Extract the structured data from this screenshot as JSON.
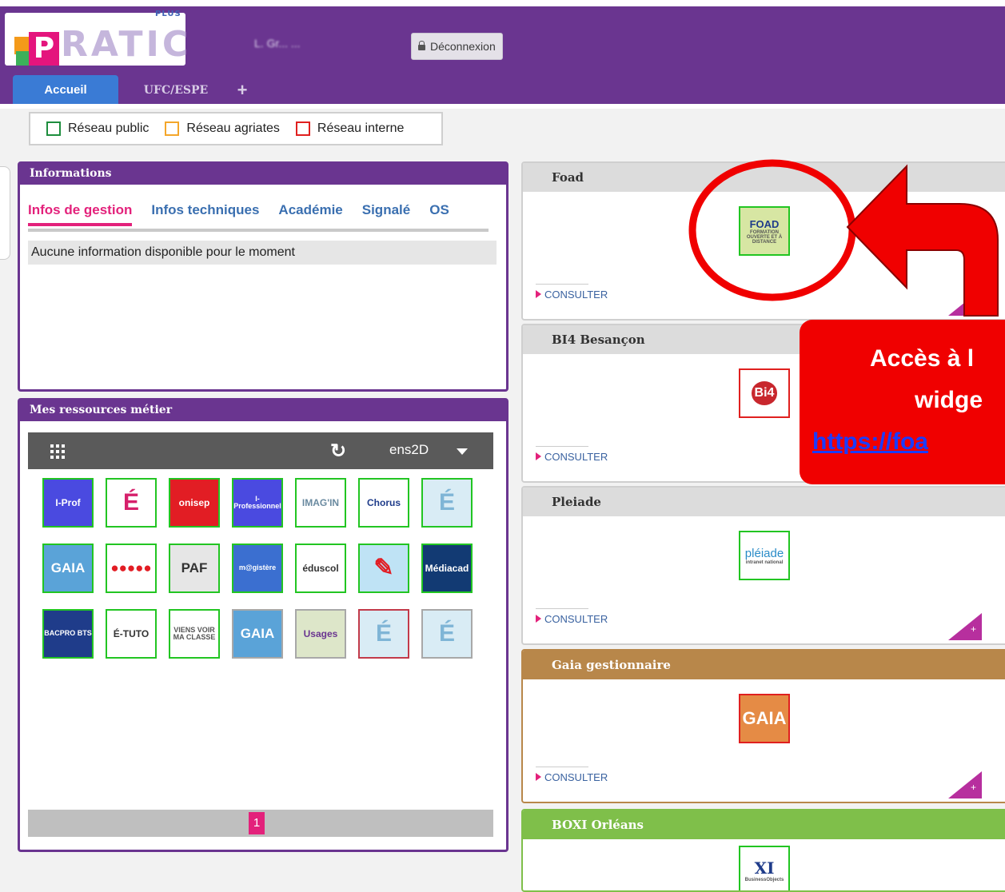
{
  "header": {
    "logo_plus": "PLUS",
    "logo_p": "P",
    "logo_word": "RATIC",
    "user_name": "L. Gr... ...",
    "logout_label": "Déconnexion",
    "tabs": [
      {
        "label": "Accueil"
      },
      {
        "label": "UFC/ESPE"
      },
      {
        "label": "+"
      }
    ]
  },
  "legend": {
    "items": [
      {
        "label": "Réseau public",
        "color": "#1e8e3e"
      },
      {
        "label": "Réseau agriates",
        "color": "#f4a62a"
      },
      {
        "label": "Réseau interne",
        "color": "#e0201f"
      }
    ]
  },
  "informations": {
    "title": "Informations",
    "tabs": [
      "Infos de gestion",
      "Infos techniques",
      "Académie",
      "Signalé",
      "OS"
    ],
    "active_tab": "Infos de gestion",
    "message": "Aucune information disponible pour le moment"
  },
  "ressources": {
    "title": "Mes ressources métier",
    "profile": "ens2D",
    "page": "1",
    "tiles": [
      {
        "label": "I-Prof",
        "bg": "#4a4ae0",
        "fg": "#ffffff"
      },
      {
        "label": "É",
        "bg": "#ffffff",
        "fg": "#d6206b"
      },
      {
        "label": "onisep",
        "bg": "#e21d24",
        "fg": "#ffffff"
      },
      {
        "label": "I-Professionnel",
        "bg": "#4a4ae0",
        "fg": "#ffffff"
      },
      {
        "label": "IMAG'IN",
        "bg": "#ffffff",
        "fg": "#6a8aa0"
      },
      {
        "label": "Chorus",
        "bg": "#ffffff",
        "fg": "#1f3c8a"
      },
      {
        "label": "É",
        "bg": "#d9ecf5",
        "fg": "#7fb5d6"
      },
      {
        "label": "GAIA",
        "bg": "#5aa3d8",
        "fg": "#ffffff"
      },
      {
        "label": "●●●●●",
        "bg": "#ffffff",
        "fg": "#e21d24"
      },
      {
        "label": "PAF",
        "bg": "#e6e6e6",
        "fg": "#333333"
      },
      {
        "label": "m@gistère",
        "bg": "#3b6fd0",
        "fg": "#ffffff"
      },
      {
        "label": "éduscol",
        "bg": "#ffffff",
        "fg": "#333333"
      },
      {
        "label": "✎",
        "bg": "#bfe3f5",
        "fg": "#e21d24"
      },
      {
        "label": "Médiacad",
        "bg": "#123a73",
        "fg": "#ffffff"
      },
      {
        "label": "BACPRO BTS",
        "bg": "#1f3c8a",
        "fg": "#ffffff"
      },
      {
        "label": "É-TUTO",
        "bg": "#ffffff",
        "fg": "#333333"
      },
      {
        "label": "VIENS VOIR MA CLASSE",
        "bg": "#ffffff",
        "fg": "#555555"
      },
      {
        "label": "GAIA",
        "bg": "#5aa3d8",
        "fg": "#ffffff"
      },
      {
        "label": "Usages",
        "bg": "#dde6c9",
        "fg": "#6a3590"
      },
      {
        "label": "É",
        "bg": "#d9ecf5",
        "fg": "#7fb5d6"
      },
      {
        "label": "É",
        "bg": "#d9ecf5",
        "fg": "#7fb5d6"
      }
    ]
  },
  "widgets": [
    {
      "title": "Foad",
      "consult": "CONSULTER",
      "logo": "FOAD",
      "logo_sub": "FORMATION OUVERTE ET À DISTANCE",
      "header_color": "#dcdcdc",
      "logo_border": "#22c522"
    },
    {
      "title": "BI4 Besançon",
      "consult": "CONSULTER",
      "logo": "Bi4",
      "header_color": "#dcdcdc",
      "logo_border": "#e0201f"
    },
    {
      "title": "Pleiade",
      "consult": "CONSULTER",
      "logo": "pléiade",
      "logo_sub": "intranet national",
      "header_color": "#dcdcdc",
      "logo_border": "#22c522"
    },
    {
      "title": "Gaia gestionnaire",
      "consult": "CONSULTER",
      "logo": "GAIA",
      "header_color": "#b8874a",
      "logo_border": "#e0201f"
    },
    {
      "title": "BOXI Orléans",
      "logo": "XI",
      "logo_sub": "BusinessObjects",
      "header_color": "#7fbf4a",
      "logo_border": "#22c522"
    }
  ],
  "callout": {
    "line1": "Accès à l",
    "line2": "widge",
    "line3": "https://foa"
  },
  "widget_plus": "+"
}
